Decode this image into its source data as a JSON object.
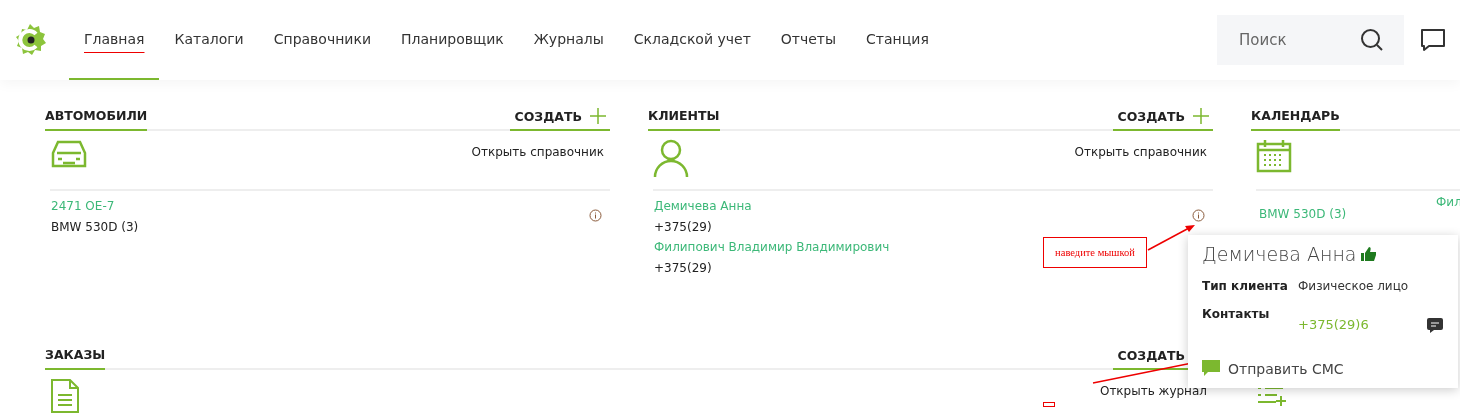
{
  "nav": {
    "items": [
      {
        "label": "Главная",
        "selected": true
      },
      {
        "label": "Каталоги",
        "selected": false
      },
      {
        "label": "Справочники",
        "selected": false
      },
      {
        "label": "Планировщик",
        "selected": false
      },
      {
        "label": "Журналы",
        "selected": false
      },
      {
        "label": "Складской учет",
        "selected": false
      },
      {
        "label": "Отчеты",
        "selected": false
      },
      {
        "label": "Станция",
        "selected": false
      }
    ],
    "search": {
      "placeholder": "Поиск"
    }
  },
  "cars": {
    "title": "АВТОМОБИЛИ",
    "create": "СОЗДАТЬ",
    "open_link": "Открыть справочник",
    "items": [
      {
        "title": "2471 OE-7",
        "subtitle": "BMW 530D (3)"
      }
    ]
  },
  "clients": {
    "title": "КЛИЕНТЫ",
    "create": "СОЗДАТЬ",
    "open_link": "Открыть справочник",
    "items": [
      {
        "title": "Демичева Анна",
        "subtitle": "+375(29)"
      },
      {
        "title": "Филипович Владимир Владимирович",
        "subtitle": "+375(29)"
      }
    ]
  },
  "calendar": {
    "title": "КАЛЕНДАРЬ",
    "events": [
      "BMW 530D (3)",
      "Фил"
    ]
  },
  "orders": {
    "title": "ЗАКАЗЫ",
    "create": "СОЗДАТЬ",
    "open_link": "Открыть журнал"
  },
  "popup": {
    "name": "Демичева Анна",
    "rows": [
      {
        "label": "Тип клиента",
        "value": "Физическое лицо",
        "kind": "text"
      },
      {
        "label": "Контакты",
        "value": "+375(29)6",
        "kind": "phone"
      }
    ],
    "action": "Отправить СМС"
  },
  "annotation": {
    "text": "наведите мышкой"
  }
}
